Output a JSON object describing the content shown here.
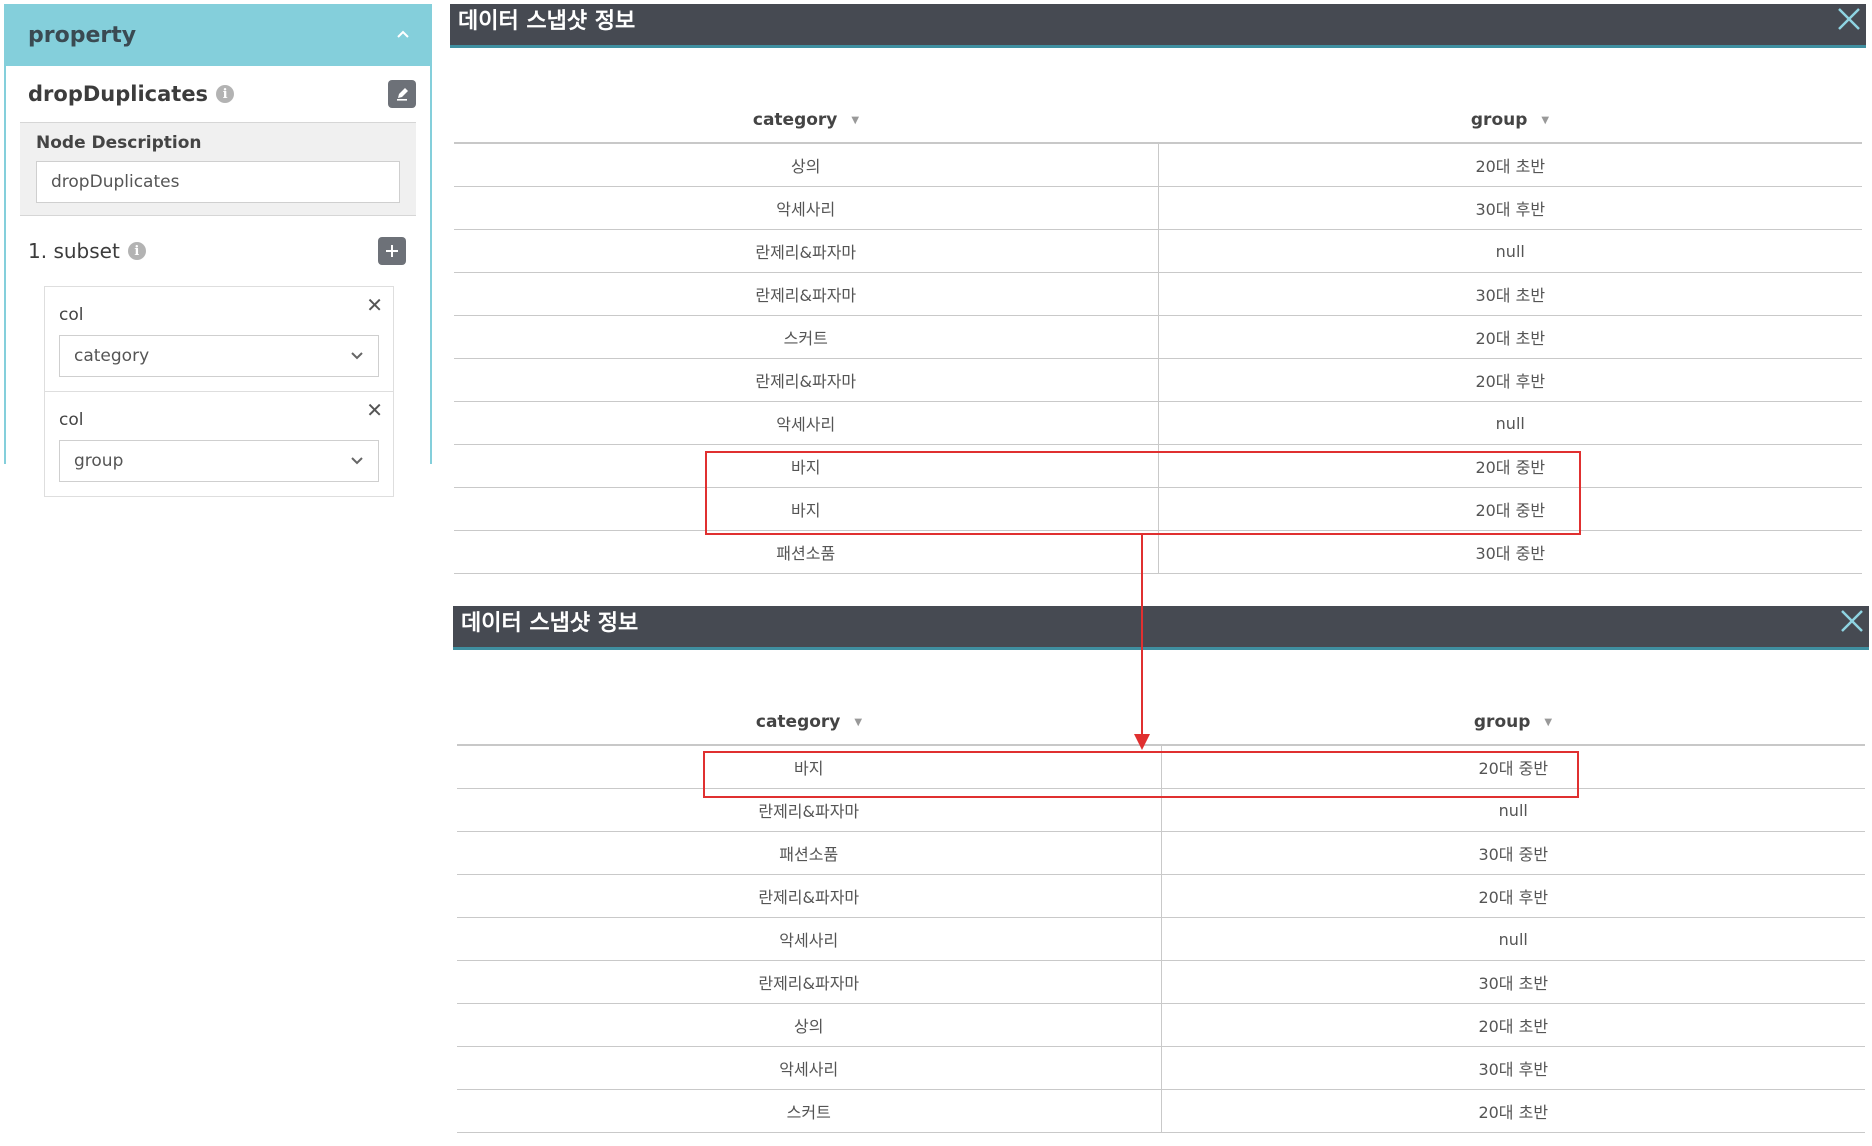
{
  "property_panel": {
    "header_title": "property",
    "node_name": "dropDuplicates",
    "node_description_label": "Node Description",
    "node_description_value": "dropDuplicates",
    "subset_label": "1. subset",
    "cols": [
      {
        "label": "col",
        "value": "category"
      },
      {
        "label": "col",
        "value": "group"
      }
    ],
    "icons": {
      "collapse": "chevron-up-icon",
      "info": "info-icon",
      "edit": "edit-icon",
      "add": "plus-icon",
      "remove": "close-icon",
      "dropdown": "chevron-down-icon"
    }
  },
  "snapshot_before": {
    "title": "데이터 스냅샷 정보",
    "columns": [
      "category",
      "group"
    ],
    "rows": [
      [
        "상의",
        "20대 초반"
      ],
      [
        "악세사리",
        "30대 후반"
      ],
      [
        "란제리&파자마",
        "null"
      ],
      [
        "란제리&파자마",
        "30대 초반"
      ],
      [
        "스커트",
        "20대 초반"
      ],
      [
        "란제리&파자마",
        "20대 후반"
      ],
      [
        "악세사리",
        "null"
      ],
      [
        "바지",
        "20대 중반"
      ],
      [
        "바지",
        "20대 중반"
      ],
      [
        "패션소품",
        "30대 중반"
      ]
    ]
  },
  "snapshot_after": {
    "title": "데이터 스냅샷 정보",
    "columns": [
      "category",
      "group"
    ],
    "rows": [
      [
        "바지",
        "20대 중반"
      ],
      [
        "란제리&파자마",
        "null"
      ],
      [
        "패션소품",
        "30대 중반"
      ],
      [
        "란제리&파자마",
        "20대 후반"
      ],
      [
        "악세사리",
        "null"
      ],
      [
        "란제리&파자마",
        "30대 초반"
      ],
      [
        "상의",
        "20대 초반"
      ],
      [
        "악세사리",
        "30대 후반"
      ],
      [
        "스커트",
        "20대 초반"
      ]
    ]
  },
  "colors": {
    "panel_accent": "#84cfdb",
    "title_bar": "#464a52",
    "highlight": "#e03030"
  }
}
